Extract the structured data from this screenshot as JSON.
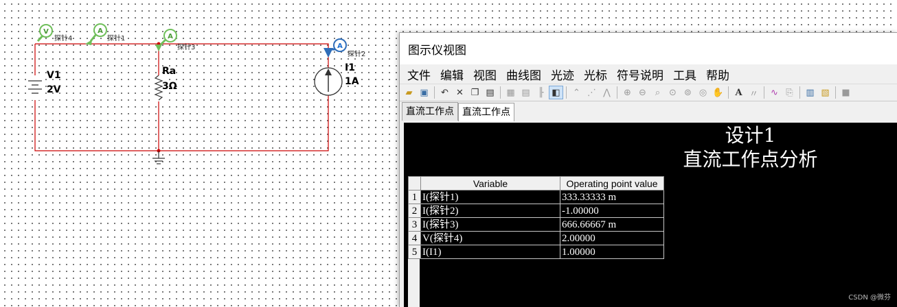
{
  "schematic": {
    "probes": [
      {
        "kind": "V",
        "label": "探针4"
      },
      {
        "kind": "A",
        "label": "探针1"
      },
      {
        "kind": "A",
        "label": "探针3"
      },
      {
        "kind": "A",
        "label": "探针2"
      }
    ],
    "components": {
      "v1": {
        "name": "V1",
        "value": "2V"
      },
      "ra": {
        "name": "Ra",
        "value": "3Ω"
      },
      "i1": {
        "name": "I1",
        "value": "1A"
      }
    }
  },
  "grapher": {
    "window_title": "图示仪视图",
    "menu": [
      "文件",
      "编辑",
      "视图",
      "曲线图",
      "光迹",
      "光标",
      "符号说明",
      "工具",
      "帮助"
    ],
    "tabs": [
      {
        "label": "直流工作点",
        "active": false
      },
      {
        "label": "直流工作点",
        "active": true
      }
    ],
    "title": "设计1",
    "subtitle": "直流工作点分析",
    "table": {
      "headers": [
        "Variable",
        "Operating point value"
      ],
      "rows": [
        {
          "num": "1",
          "variable": "I(探针1)",
          "value": "333.33333 m"
        },
        {
          "num": "2",
          "variable": "I(探针2)",
          "value": "-1.00000"
        },
        {
          "num": "3",
          "variable": "I(探针3)",
          "value": "666.66667 m"
        },
        {
          "num": "4",
          "variable": "V(探针4)",
          "value": "2.00000"
        },
        {
          "num": "5",
          "variable": "I(I1)",
          "value": "1.00000"
        }
      ]
    }
  },
  "watermark": "CSDN @微芬",
  "colors": {
    "wire": "#cc0000",
    "probe": "#4caf50",
    "probe_active": "#1e6fd0",
    "graph_bg": "#000000"
  }
}
